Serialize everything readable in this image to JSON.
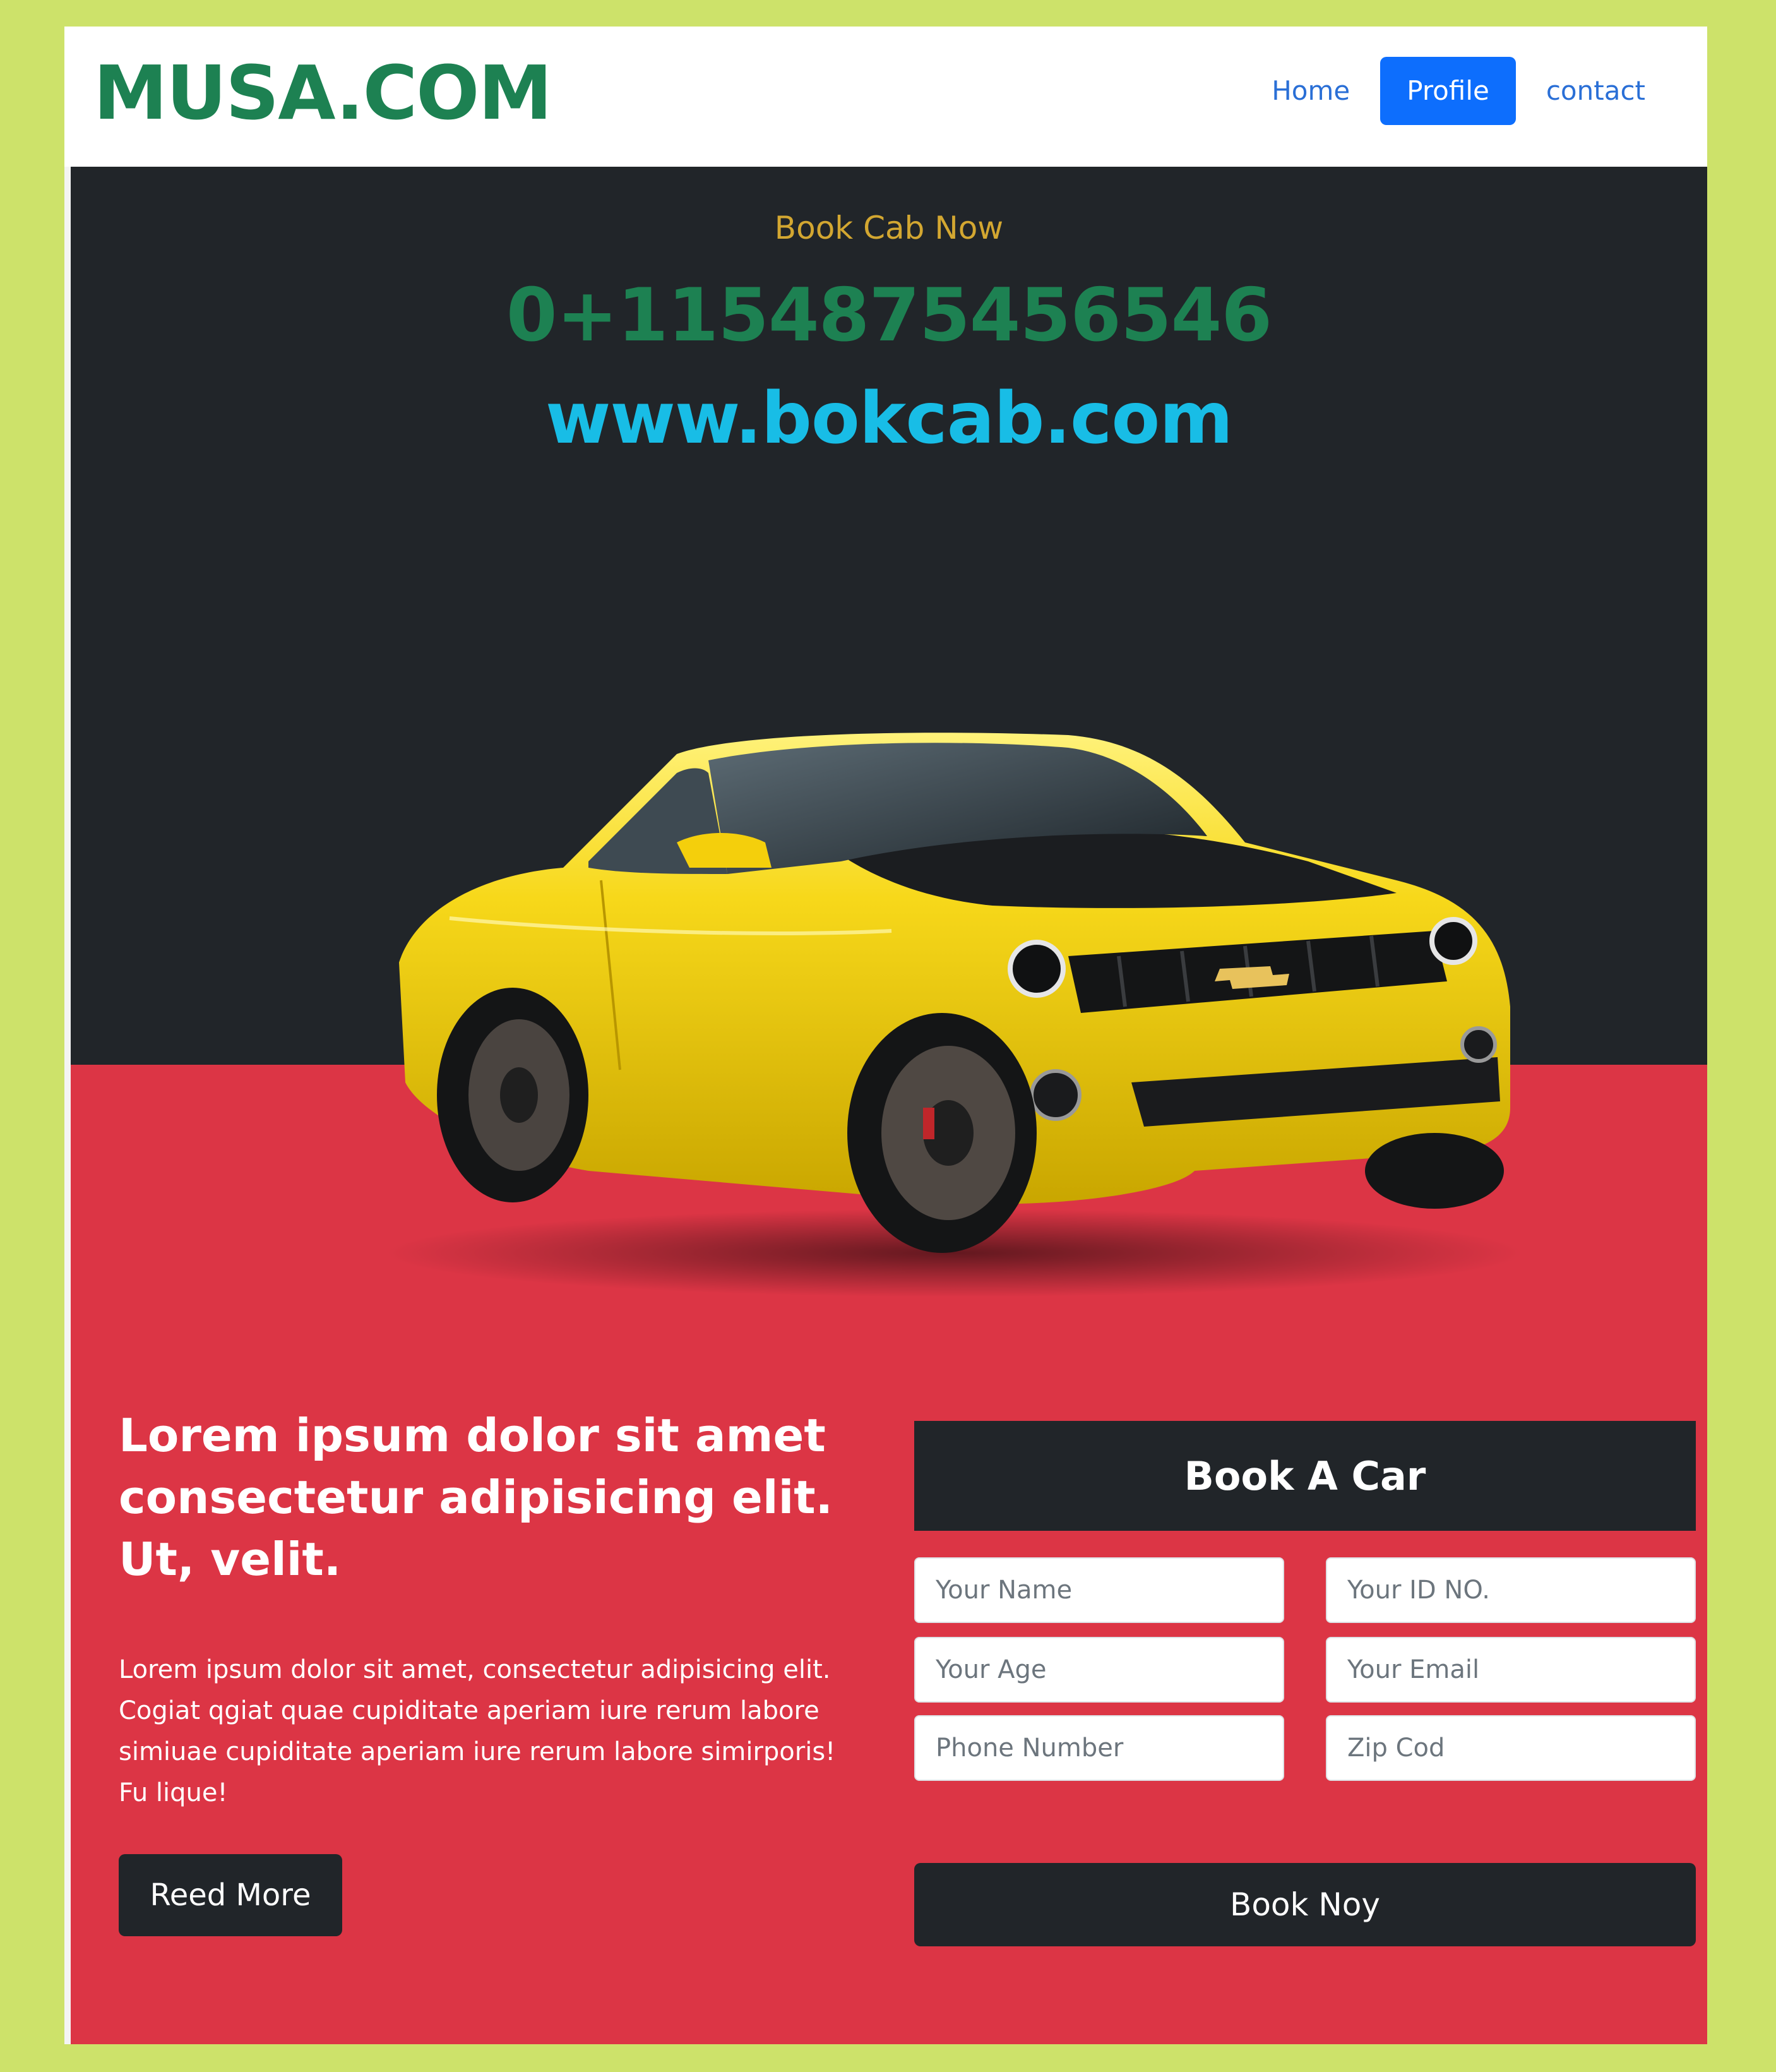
{
  "navbar": {
    "brand": "MUSA.COM",
    "links": [
      {
        "label": "Home"
      },
      {
        "label": "Profile",
        "active": true
      },
      {
        "label": "contact"
      }
    ]
  },
  "hero": {
    "kicker": "Book Cab Now",
    "phone": "0+1154875456546",
    "website": "www.bokcab.com",
    "image": "yellow-sports-car"
  },
  "intro": {
    "title": "Lorem ipsum dolor sit amet consectetur adipisicing elit. Ut, velit.",
    "body": "Lorem ipsum dolor sit amet, consectetur adipisicing elit. Cogiat qgiat quae cupiditate aperiam iure rerum labore simiuae cupiditate aperiam iure rerum labore simirporis! Fu lique!",
    "button": "Reed More"
  },
  "form": {
    "title": "Book A Car",
    "fields": {
      "name": {
        "placeholder": "Your Name",
        "value": ""
      },
      "id_no": {
        "placeholder": "Your ID NO.",
        "value": ""
      },
      "age": {
        "placeholder": "Your Age",
        "value": ""
      },
      "email": {
        "placeholder": "Your Email",
        "value": ""
      },
      "phone": {
        "placeholder": "Phone Number",
        "value": ""
      },
      "zip": {
        "placeholder": "Zip Cod",
        "value": ""
      }
    },
    "submit": "Book Noy"
  },
  "colors": {
    "outer_background": "#cde26a",
    "brand_green": "#1d8152",
    "dark": "#212529",
    "red": "#dc3545",
    "link_blue": "#2a6fd6",
    "active_blue": "#0d6efd",
    "kicker_gold": "#d3a731",
    "site_cyan": "#18bde6"
  }
}
